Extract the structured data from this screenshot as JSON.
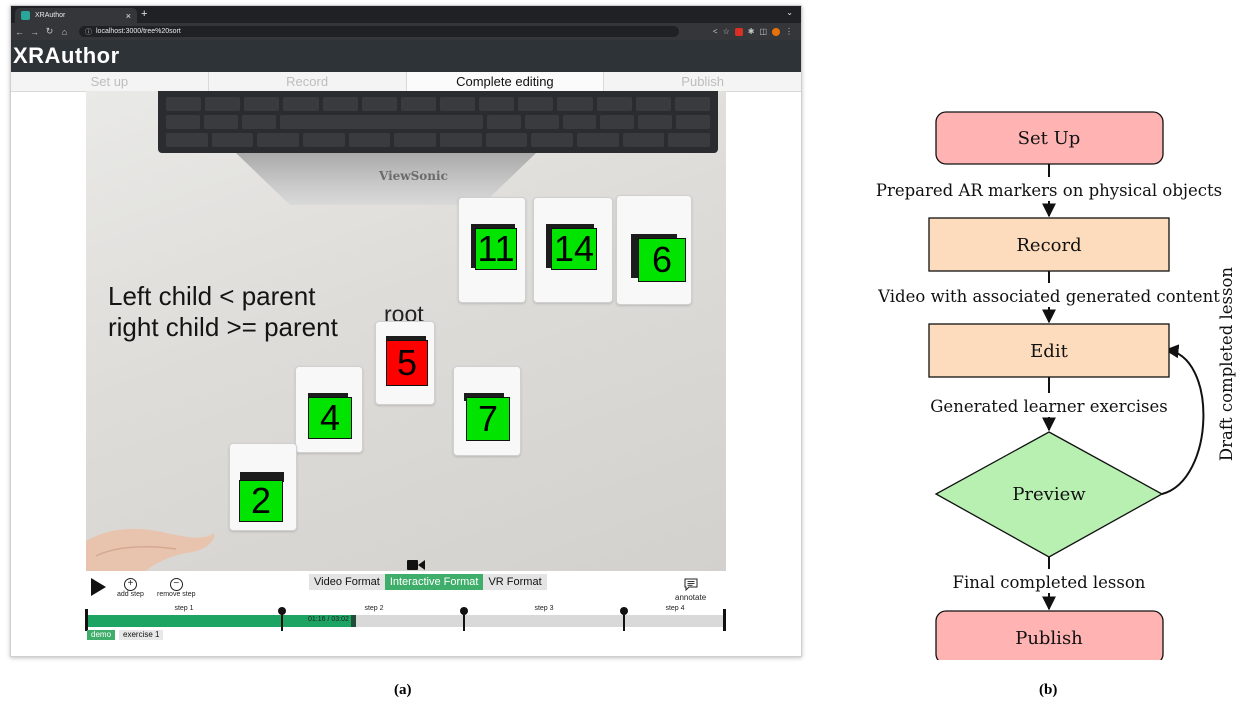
{
  "browser": {
    "tab_title": "XRAuthor",
    "tab_close": "×",
    "new_tab": "+",
    "url": "localhost:3000/tree%20sort"
  },
  "app": {
    "title": "XRAuthor",
    "steps": [
      "Set up",
      "Record",
      "Complete editing",
      "Publish"
    ],
    "active_step": "Complete editing"
  },
  "video": {
    "brand": "ViewSonic",
    "overlay_text": [
      "Left child < parent",
      "right child >= parent"
    ],
    "root_label": "root",
    "cards": [
      {
        "number": "11",
        "color": "green"
      },
      {
        "number": "14",
        "color": "green"
      },
      {
        "number": "6",
        "color": "green"
      },
      {
        "number": "5",
        "color": "red"
      },
      {
        "number": "4",
        "color": "green"
      },
      {
        "number": "7",
        "color": "green"
      },
      {
        "number": "2",
        "color": "green"
      }
    ]
  },
  "controls": {
    "add_step": "add step",
    "remove_step": "remove step",
    "formats": [
      "Video Format",
      "Interactive Format",
      "VR Format"
    ],
    "active_format": "Interactive Format",
    "annotate": "annotate",
    "timeline_steps": [
      "step 1",
      "step 2",
      "step 3",
      "step 4"
    ],
    "timecode": "01:16 / 03:02",
    "progress_fraction": 0.418,
    "exercise_tabs": [
      "demo",
      "exercise 1"
    ]
  },
  "captions": {
    "a": "(a)",
    "b": "(b)"
  },
  "flowchart": {
    "nodes": [
      "Set Up",
      "Record",
      "Edit",
      "Preview",
      "Publish"
    ],
    "edge_labels": [
      "Prepared AR markers on physical objects",
      "Video with associated generated content",
      "Generated learner exercises",
      "Final completed lesson"
    ],
    "feedback_label": "Draft completed lesson",
    "colors": {
      "terminal": "#ffb3b3",
      "process": "#fddcbd",
      "decision": "#b7f0b1"
    }
  }
}
